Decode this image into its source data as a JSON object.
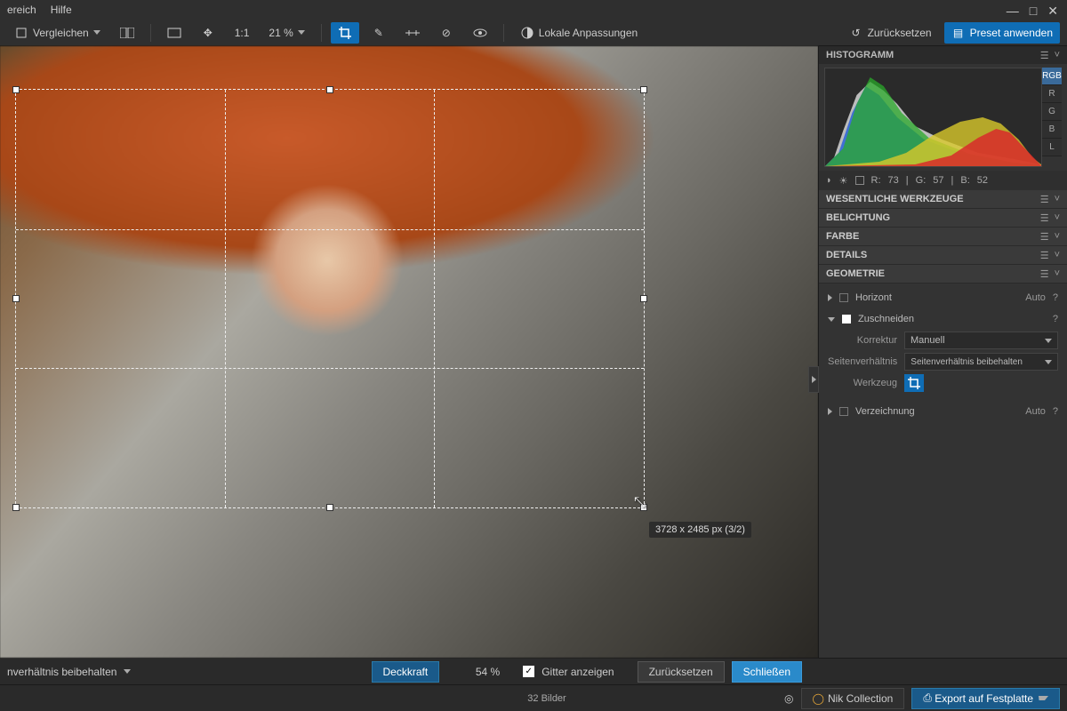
{
  "menubar": {
    "items": [
      "ereich",
      "Hilfe"
    ]
  },
  "toolbar": {
    "compare": "Vergleichen",
    "zoom": "21 %",
    "local": "Lokale Anpassungen",
    "reset": "Zurücksetzen",
    "preset": "Preset anwenden"
  },
  "crop": {
    "dimensions": "3728 x 2485 px (3/2)"
  },
  "side": {
    "histogram": {
      "title": "HISTOGRAMM",
      "tabs": [
        "RGB",
        "R",
        "G",
        "B",
        "L"
      ],
      "rgb": {
        "r": "R:",
        "rv": "73",
        "g": "G:",
        "gv": "57",
        "b": "B:",
        "bv": "52"
      }
    },
    "panels": [
      "WESENTLICHE WERKZEUGE",
      "BELICHTUNG",
      "FARBE",
      "DETAILS",
      "GEOMETRIE"
    ],
    "geo": {
      "horizont": "Horizont",
      "auto": "Auto",
      "help": "?",
      "crop": "Zuschneiden",
      "korrektur": {
        "label": "Korrektur",
        "value": "Manuell"
      },
      "aspect": {
        "label": "Seitenverhältnis",
        "value": "Seitenverhältnis beibehalten"
      },
      "tool": {
        "label": "Werkzeug"
      },
      "verz": "Verzeichnung"
    }
  },
  "bottom": {
    "aspect": "nverhältnis beibehalten",
    "opacity": "Deckkraft",
    "opacity_val": "54 %",
    "grid": "Gitter anzeigen",
    "reset": "Zurücksetzen",
    "close": "Schließen"
  },
  "footer": {
    "count": "32 Bilder",
    "nik": "Nik Collection",
    "export": "Export auf Festplatte"
  }
}
